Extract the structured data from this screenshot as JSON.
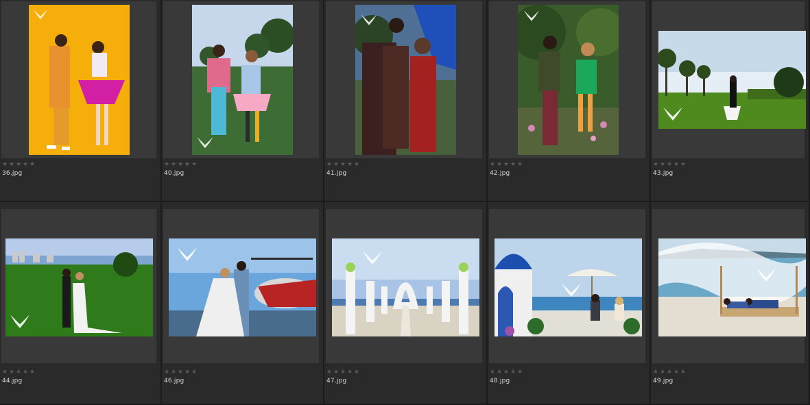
{
  "browser": {
    "thumbnails": [
      {
        "filename": "36.jpg",
        "rating": 0,
        "orientation": "portrait",
        "scene": "yellow-studio"
      },
      {
        "filename": "40.jpg",
        "rating": 0,
        "orientation": "portrait",
        "scene": "park-colorful"
      },
      {
        "filename": "41.jpg",
        "rating": 0,
        "orientation": "portrait",
        "scene": "street-sign"
      },
      {
        "filename": "42.jpg",
        "rating": 0,
        "orientation": "portrait",
        "scene": "garden"
      },
      {
        "filename": "43.jpg",
        "rating": 0,
        "orientation": "landscape",
        "scene": "beach-palms"
      },
      {
        "filename": "44.jpg",
        "rating": 0,
        "orientation": "landscape",
        "scene": "golf-course"
      },
      {
        "filename": "46.jpg",
        "rating": 0,
        "orientation": "landscape",
        "scene": "helicopter"
      },
      {
        "filename": "47.jpg",
        "rating": 0,
        "orientation": "landscape",
        "scene": "white-arch"
      },
      {
        "filename": "48.jpg",
        "rating": 0,
        "orientation": "landscape",
        "scene": "santorini"
      },
      {
        "filename": "49.jpg",
        "rating": 0,
        "orientation": "landscape",
        "scene": "beach-bed"
      }
    ]
  },
  "colors": {
    "background": "#262626",
    "panel": "#393939",
    "star_empty": "#5a5a5a",
    "text": "#d8d8d8"
  }
}
